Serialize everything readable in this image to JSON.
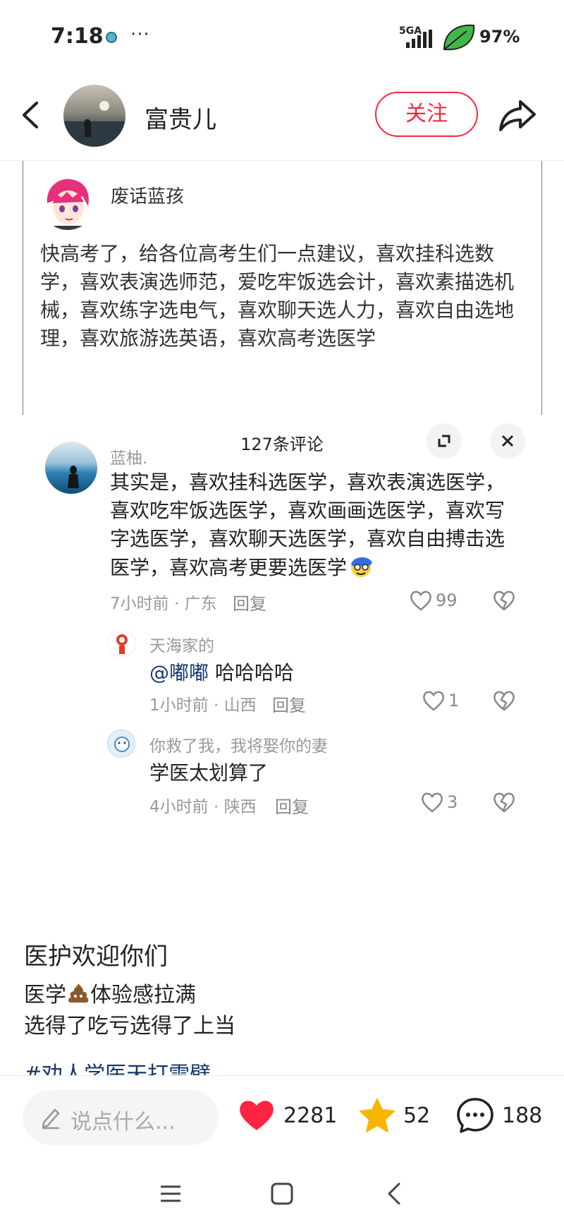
{
  "status_bar": {
    "time": "7:18",
    "dots": "···",
    "network": "5GA",
    "battery": "97%"
  },
  "header": {
    "author": "富贵儿",
    "follow_label": "关注"
  },
  "quoted_post": {
    "author": "废话蓝孩",
    "text": "快高考了，给各位高考生们一点建议，喜欢挂科选数学，喜欢表演选师范，爱吃牢饭选会计，喜欢素描选机械，喜欢练字选电气，喜欢聊天选人力，喜欢自由选地理，喜欢旅游选英语，喜欢高考选医学"
  },
  "comments_panel": {
    "title": "127条评论",
    "comments": [
      {
        "user": "蓝柚.",
        "text": "其实是，喜欢挂科选医学，喜欢表演选医学，喜欢吃牢饭选医学，喜欢画画选医学，喜欢写字选医学，喜欢聊天选医学，喜欢自由搏击选医学，喜欢高考更要选医学",
        "meta": "7小时前 · 广东",
        "reply_label": "回复",
        "likes": "99"
      }
    ],
    "replies": [
      {
        "user": "天海家的",
        "mention": "@嘟嘟",
        "text": "哈哈哈哈",
        "meta": "1小时前 · 山西",
        "reply_label": "回复",
        "likes": "1"
      },
      {
        "user": "你救了我，我将娶你的妻",
        "text": "学医太划算了",
        "meta": "4小时前 · 陕西",
        "reply_label": "回复",
        "likes": "3"
      }
    ]
  },
  "post_body": {
    "title": "医护欢迎你们",
    "line1_a": "医学",
    "line1_b": "体验感拉满",
    "line2": "选得了吃亏选得了上当",
    "hashtag": "#劝人学医天打雷劈"
  },
  "bottom_bar": {
    "input_placeholder": "说点什么...",
    "likes": "2281",
    "stars": "52",
    "comments": "188"
  },
  "icons": {
    "accent": "#ff2442",
    "star": "#f7b500",
    "mention": "#13386c"
  }
}
